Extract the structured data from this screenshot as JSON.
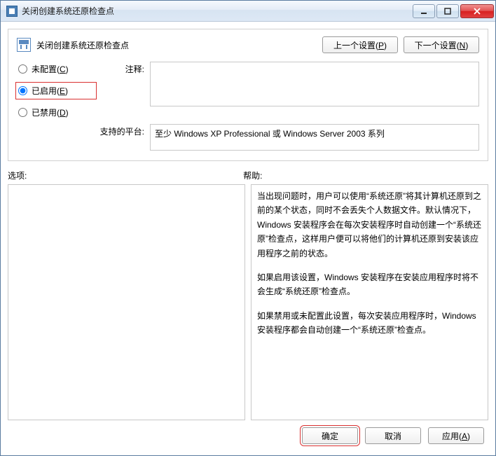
{
  "window": {
    "title": "关闭创建系统还原检查点"
  },
  "panel": {
    "title": "关闭创建系统还原检查点",
    "prevSetting": "上一个设置(P)",
    "nextSetting": "下一个设置(N)"
  },
  "radios": {
    "unconfigured": "未配置(C)",
    "enabled": "已启用(E)",
    "disabled": "已禁用(D)"
  },
  "labels": {
    "note": "注释:",
    "platform": "支持的平台:",
    "options": "选项:",
    "help": "帮助:"
  },
  "values": {
    "note": "",
    "platform": "至少 Windows XP Professional 或 Windows Server 2003 系列"
  },
  "help": {
    "p1": "当出现问题时，用户可以使用“系统还原”将其计算机还原到之前的某个状态，同时不会丢失个人数据文件。默认情况下，Windows 安装程序会在每次安装程序时自动创建一个“系统还原”检查点，这样用户便可以将他们的计算机还原到安装该应用程序之前的状态。",
    "p2": "如果启用该设置，Windows 安装程序在安装应用程序时将不会生成“系统还原”检查点。",
    "p3": "如果禁用或未配置此设置，每次安装应用程序时，Windows 安装程序都会自动创建一个“系统还原”检查点。"
  },
  "buttons": {
    "ok": "确定",
    "cancel": "取消",
    "apply": "应用(A)"
  }
}
